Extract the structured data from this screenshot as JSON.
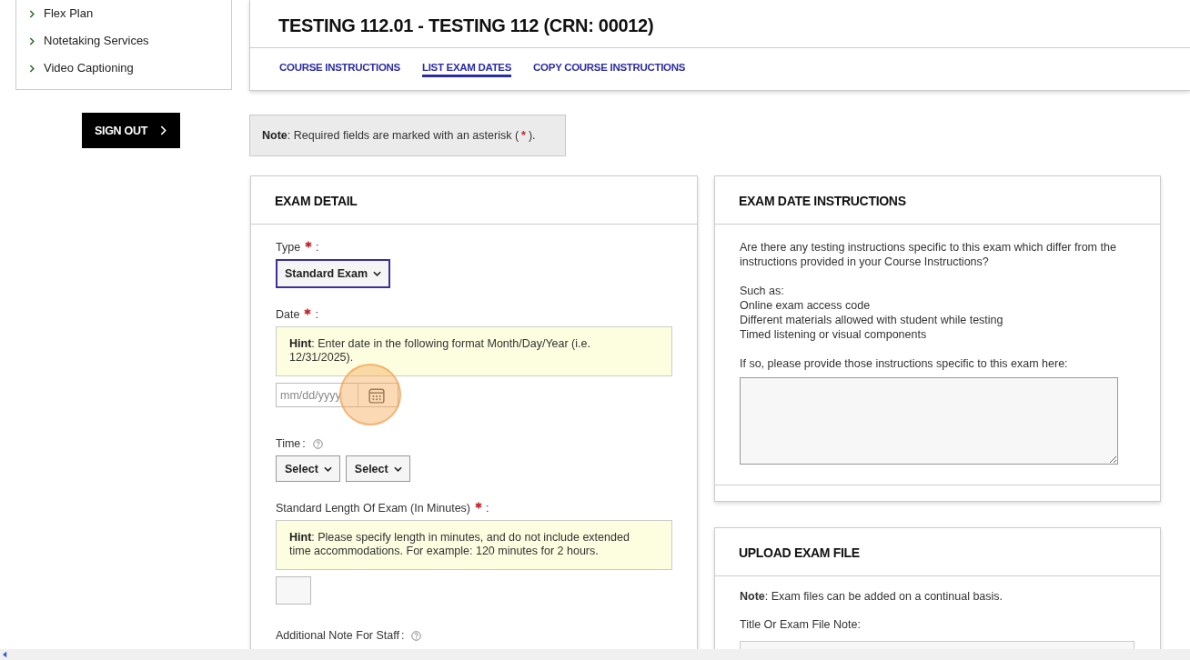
{
  "sidebar": {
    "items": [
      {
        "label": "Flex Plan"
      },
      {
        "label": "Notetaking Services"
      },
      {
        "label": "Video Captioning"
      }
    ]
  },
  "sign_out": {
    "label": "SIGN OUT"
  },
  "course_header": {
    "title": "TESTING 112.01 - TESTING 112 (CRN: 00012)",
    "tabs": [
      {
        "label": "COURSE INSTRUCTIONS",
        "selected": false
      },
      {
        "label": "LIST EXAM DATES",
        "selected": true
      },
      {
        "label": "COPY COURSE INSTRUCTIONS",
        "selected": false
      }
    ]
  },
  "note": {
    "bold": "Note",
    "text": ": Required fields are marked with an asterisk (",
    "mark": "*",
    "end": ")."
  },
  "exam_detail": {
    "title": "EXAM DETAIL",
    "fields": [
      {
        "kind": "select",
        "label": "Type",
        "label_end": ":",
        "required": true,
        "value": "Standard Exam",
        "focused": true
      },
      {
        "kind": "date",
        "label": "Date",
        "label_end": ":",
        "required": true,
        "hint": {
          "bold": "Hint",
          "text": ": Enter date in the following format Month/Day/Year (i.e. 12/31/2025)."
        },
        "placeholder": "mm/dd/yyyy"
      },
      {
        "kind": "time",
        "label": "Time",
        "label_end": ":",
        "help": true,
        "selects": [
          "Select",
          "Select"
        ]
      },
      {
        "kind": "number",
        "label": "Standard Length Of Exam (In Minutes)",
        "label_end": ":",
        "required": true,
        "hint": {
          "bold": "Hint",
          "text": ": Please specify length in minutes, and do not include extended time accommodations. For example: 120 minutes for 2 hours."
        }
      },
      {
        "kind": "note",
        "label": "Additional Note For Staff",
        "label_end": ":",
        "help": true
      }
    ]
  },
  "exam_date_instructions": {
    "title": "EXAM DATE INSTRUCTIONS",
    "question": "Are there any testing instructions specific to this exam which differ from the instructions provided in your Course Instructions?",
    "examples_label": "Such as:",
    "examples": [
      "Online exam access code",
      "Different materials allowed with student while testing",
      "Timed listening or visual components"
    ],
    "prompt": "If so, please provide those instructions specific to this exam here:"
  },
  "upload_exam_file": {
    "title": "UPLOAD EXAM FILE",
    "note": {
      "bold": "Note",
      "text": ": Exam files can be added on a continual basis."
    },
    "field_label": "Title Or Exam File Note:"
  }
}
